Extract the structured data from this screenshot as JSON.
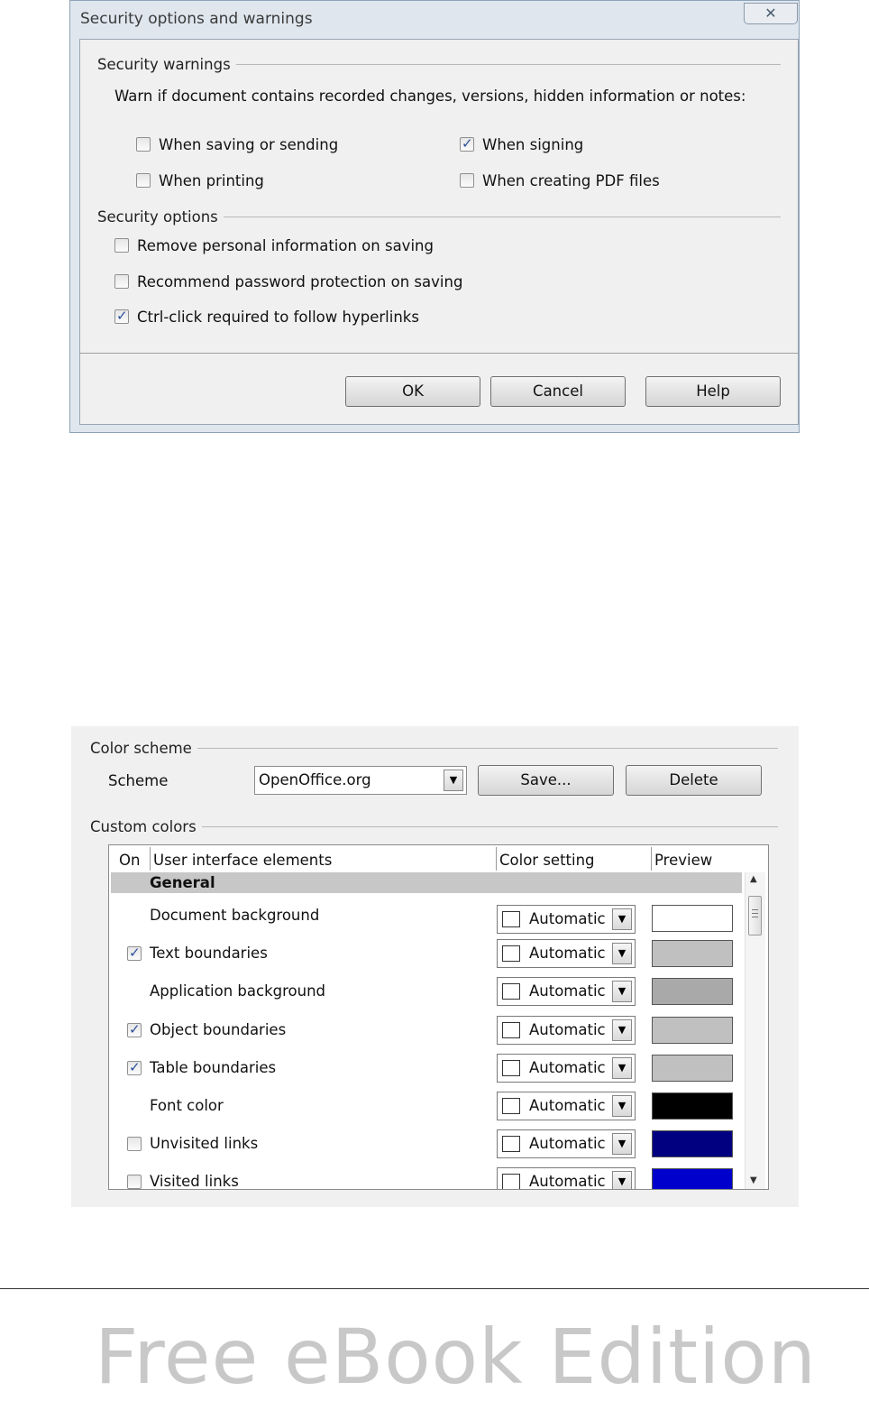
{
  "security_dialog": {
    "title": "Security options and warnings",
    "close_glyph": "✕",
    "warnings_group": {
      "title": "Security warnings",
      "description": "Warn if document contains recorded changes, versions, hidden information or notes:",
      "checkboxes": [
        {
          "label": "When saving or sending",
          "checked": false
        },
        {
          "label": "When signing",
          "checked": true
        },
        {
          "label": "When printing",
          "checked": false
        },
        {
          "label": "When creating PDF files",
          "checked": false
        }
      ]
    },
    "options_group": {
      "title": "Security options",
      "checkboxes": [
        {
          "label": "Remove personal information on saving",
          "checked": false
        },
        {
          "label": "Recommend password protection on saving",
          "checked": false
        },
        {
          "label": "Ctrl-click required to follow hyperlinks",
          "checked": true
        }
      ]
    },
    "buttons": {
      "ok": "OK",
      "cancel": "Cancel",
      "help": "Help"
    }
  },
  "color_panel": {
    "scheme_group": {
      "title": "Color scheme",
      "scheme_label": "Scheme",
      "scheme_value": "OpenOffice.org",
      "save_button": "Save...",
      "delete_button": "Delete"
    },
    "custom_group": {
      "title": "Custom colors",
      "columns": {
        "on": "On",
        "elements": "User interface elements",
        "setting": "Color setting",
        "preview": "Preview"
      },
      "section_header": "General",
      "rows": [
        {
          "label": "Document background",
          "has_checkbox": false,
          "checked": false,
          "setting": "Automatic",
          "preview_color": "#ffffff"
        },
        {
          "label": "Text boundaries",
          "has_checkbox": true,
          "checked": true,
          "setting": "Automatic",
          "preview_color": "#c0c0c0"
        },
        {
          "label": "Application background",
          "has_checkbox": false,
          "checked": false,
          "setting": "Automatic",
          "preview_color": "#a9a9a9"
        },
        {
          "label": "Object boundaries",
          "has_checkbox": true,
          "checked": true,
          "setting": "Automatic",
          "preview_color": "#c0c0c0"
        },
        {
          "label": "Table boundaries",
          "has_checkbox": true,
          "checked": true,
          "setting": "Automatic",
          "preview_color": "#c0c0c0"
        },
        {
          "label": "Font color",
          "has_checkbox": false,
          "checked": false,
          "setting": "Automatic",
          "preview_color": "#000000"
        },
        {
          "label": "Unvisited links",
          "has_checkbox": true,
          "checked": false,
          "setting": "Automatic",
          "preview_color": "#000080"
        },
        {
          "label": "Visited links",
          "has_checkbox": true,
          "checked": false,
          "setting": "Automatic",
          "preview_color": "#0000cc"
        }
      ]
    }
  },
  "footer": {
    "text": "Free eBook Edition"
  }
}
